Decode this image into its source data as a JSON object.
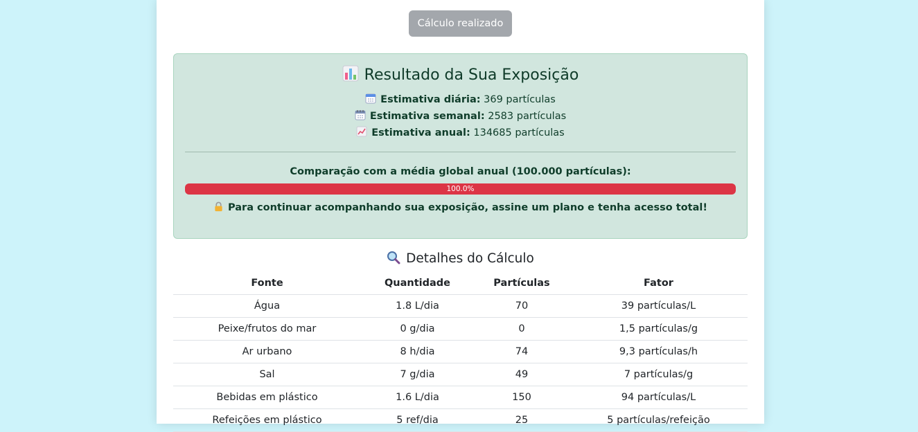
{
  "action_button": {
    "label": "Cálculo realizado"
  },
  "result": {
    "title": "Resultado da Sua Exposição",
    "title_icon": "bar-chart-icon",
    "daily": {
      "icon": "calendar-icon",
      "label": "Estimativa diária:",
      "value": "369 partículas"
    },
    "weekly": {
      "icon": "spiral-calendar-icon",
      "label": "Estimativa semanal:",
      "value": "2583 partículas"
    },
    "annual": {
      "icon": "chart-increasing-icon",
      "label": "Estimativa anual:",
      "value": "134685 partículas"
    },
    "comparison_label": "Comparação com a média global anual (100.000 partículas):",
    "progress": {
      "value": 1.0,
      "label": "100.0%",
      "color": "#dc3545"
    },
    "plan_icon": "lock-icon",
    "plan_message": "Para continuar acompanhando sua exposição, assine um plano e tenha acesso total!"
  },
  "details": {
    "title": "Detalhes do Cálculo",
    "title_icon": "magnifier-icon",
    "columns": [
      "Fonte",
      "Quantidade",
      "Partículas",
      "Fator"
    ],
    "rows": [
      [
        "Água",
        "1.8 L/dia",
        "70",
        "39 partículas/L"
      ],
      [
        "Peixe/frutos do mar",
        "0 g/dia",
        "0",
        "1,5 partículas/g"
      ],
      [
        "Ar urbano",
        "8 h/dia",
        "74",
        "9,3 partículas/h"
      ],
      [
        "Sal",
        "7 g/dia",
        "49",
        "7 partículas/g"
      ],
      [
        "Bebidas em plástico",
        "1.6 L/dia",
        "150",
        "94 partículas/L"
      ],
      [
        "Refeições em plástico",
        "5 ref/dia",
        "25",
        "5 partículas/refeição"
      ]
    ]
  },
  "colors": {
    "page_background": "#cdf3fa",
    "result_background": "#d1e6de",
    "result_border": "#a8d4be",
    "button_disabled": "#a3a7ac",
    "danger": "#dc3545"
  }
}
